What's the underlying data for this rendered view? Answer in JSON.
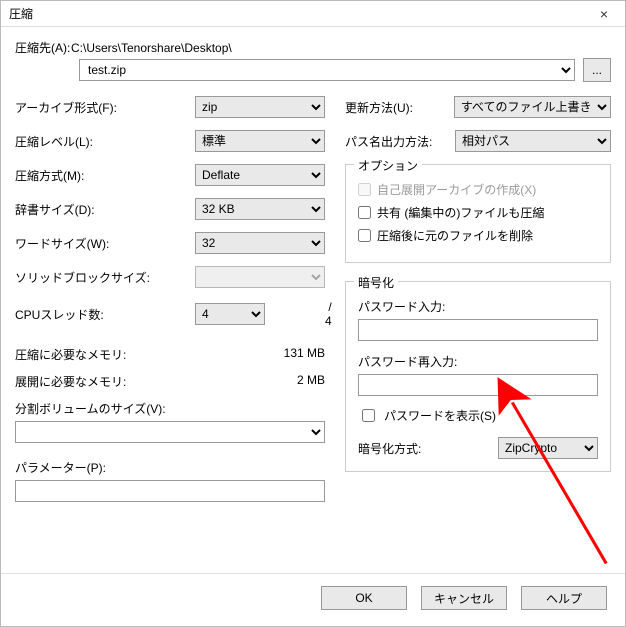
{
  "window": {
    "title": "圧縮",
    "close_glyph": "×"
  },
  "path": {
    "label": "圧縮先(A):",
    "dir": "C:\\Users\\Tenorshare\\Desktop\\",
    "file": "test.zip",
    "browse": "..."
  },
  "left": {
    "archive_format": {
      "label": "アーカイブ形式(F):",
      "value": "zip"
    },
    "level": {
      "label": "圧縮レベル(L):",
      "value": "標準"
    },
    "method": {
      "label": "圧縮方式(M):",
      "value": "Deflate"
    },
    "dict": {
      "label": "辞書サイズ(D):",
      "value": "32 KB"
    },
    "word": {
      "label": "ワードサイズ(W):",
      "value": "32"
    },
    "solid": {
      "label": "ソリッドブロックサイズ:"
    },
    "threads": {
      "label": "CPUスレッド数:",
      "value": "4",
      "total": "/ 4"
    },
    "mem_compress": {
      "label": "圧縮に必要なメモリ:",
      "value": "131 MB"
    },
    "mem_decompress": {
      "label": "展開に必要なメモリ:",
      "value": "2 MB"
    },
    "split": {
      "label": "分割ボリュームのサイズ(V):"
    },
    "params": {
      "label": "パラメーター(P):"
    }
  },
  "right": {
    "update": {
      "label": "更新方法(U):",
      "value": "すべてのファイル上書き"
    },
    "paths": {
      "label": "パス名出力方法:",
      "value": "相対パス"
    },
    "options": {
      "title": "オプション",
      "sfx": "自己展開アーカイブの作成(X)",
      "share": "共有 (編集中の)ファイルも圧縮",
      "del": "圧縮後に元のファイルを削除"
    },
    "enc": {
      "title": "暗号化",
      "pw": "パスワード入力:",
      "pw2": "パスワード再入力:",
      "show": "パスワードを表示(S)",
      "method_label": "暗号化方式:",
      "method_value": "ZipCrypto"
    }
  },
  "buttons": {
    "ok": "OK",
    "cancel": "キャンセル",
    "help": "ヘルプ"
  }
}
